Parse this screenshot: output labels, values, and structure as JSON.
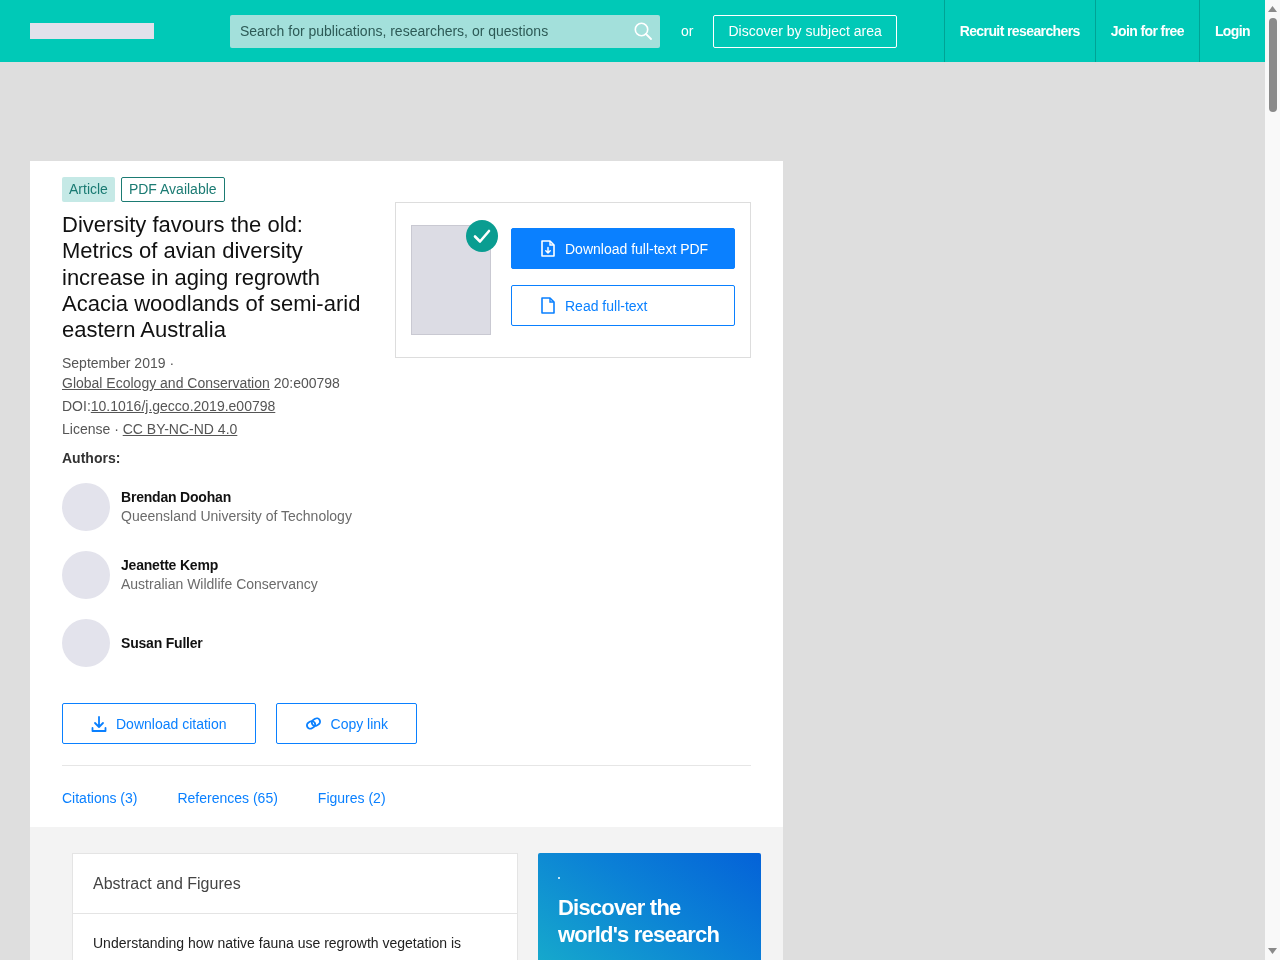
{
  "header": {
    "search": {
      "placeholder": "Search for publications, researchers, or questions"
    },
    "or_label": "or",
    "subject_button": "Discover by subject area",
    "nav": [
      "Recruit researchers",
      "Join for free",
      "Login"
    ]
  },
  "article": {
    "tags": [
      {
        "label": "Article",
        "kind": "filled"
      },
      {
        "label": "PDF Available",
        "kind": "outline"
      }
    ],
    "title": "Diversity favours the old: Metrics of avian diversity increase in aging regrowth Acacia woodlands of semi-arid eastern Australia",
    "publication": {
      "date": "September 2019",
      "separator": "·",
      "journal": "Global Ecology and Conservation",
      "volume": "20:e00798"
    },
    "doi": {
      "label": "DOI:",
      "value": "10.1016/j.gecco.2019.e00798"
    },
    "license": {
      "label": "License",
      "separator": "·",
      "value": "CC BY-NC-ND 4.0"
    },
    "authors_label": "Authors:",
    "authors": [
      {
        "name": "Brendan Doohan",
        "affiliation": "Queensland University of Technology"
      },
      {
        "name": "Jeanette Kemp",
        "affiliation": "Australian Wildlife Conservancy"
      },
      {
        "name": "Susan Fuller"
      }
    ],
    "actions": [
      {
        "label": "Download citation",
        "kind": "download"
      },
      {
        "label": "Copy link",
        "kind": "link"
      }
    ],
    "section_links": [
      "Citations (3)",
      "References (65)",
      "Figures (2)"
    ]
  },
  "fulltext_panel": {
    "buttons": [
      {
        "label": "Download full-text PDF",
        "kind": "primary"
      },
      {
        "label": "Read full-text",
        "kind": "secondary"
      }
    ]
  },
  "abstract": {
    "heading": "Abstract and Figures",
    "text": "Understanding how native fauna use regrowth vegetation is"
  },
  "promo": {
    "heading": "Discover the world's research"
  }
}
